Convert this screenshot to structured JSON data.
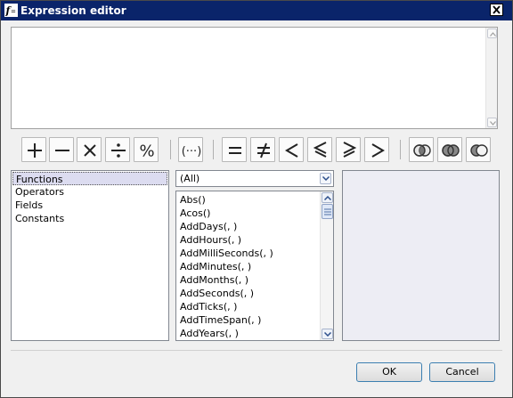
{
  "window": {
    "title": "Expression editor",
    "close_glyph": "×"
  },
  "editor": {
    "value": ""
  },
  "toolbar": {
    "arithmetic": [
      "plus-icon",
      "minus-icon",
      "multiply-icon",
      "divide-icon",
      "percent-icon"
    ],
    "grouping": [
      "parentheses-icon"
    ],
    "comparison": [
      "equals-icon",
      "not-equals-icon",
      "less-than-icon",
      "less-or-equal-icon",
      "greater-or-equal-icon",
      "greater-than-icon"
    ],
    "logical": [
      "and-icon",
      "or-icon",
      "not-icon"
    ]
  },
  "categories": {
    "selected_index": 0,
    "items": [
      "Functions",
      "Operators",
      "Fields",
      "Constants"
    ]
  },
  "filter": {
    "selected": "(All)"
  },
  "functions": {
    "items": [
      "Abs()",
      "Acos()",
      "AddDays(, )",
      "AddHours(, )",
      "AddMilliSeconds(, )",
      "AddMinutes(, )",
      "AddMonths(, )",
      "AddSeconds(, )",
      "AddTicks(, )",
      "AddTimeSpan(, )",
      "AddYears(, )"
    ]
  },
  "description": {
    "text": ""
  },
  "buttons": {
    "ok": "OK",
    "cancel": "Cancel"
  },
  "colors": {
    "titlebar": "#0a246a",
    "selection": "#dcdcf0",
    "button_border": "#3c7fb1"
  }
}
